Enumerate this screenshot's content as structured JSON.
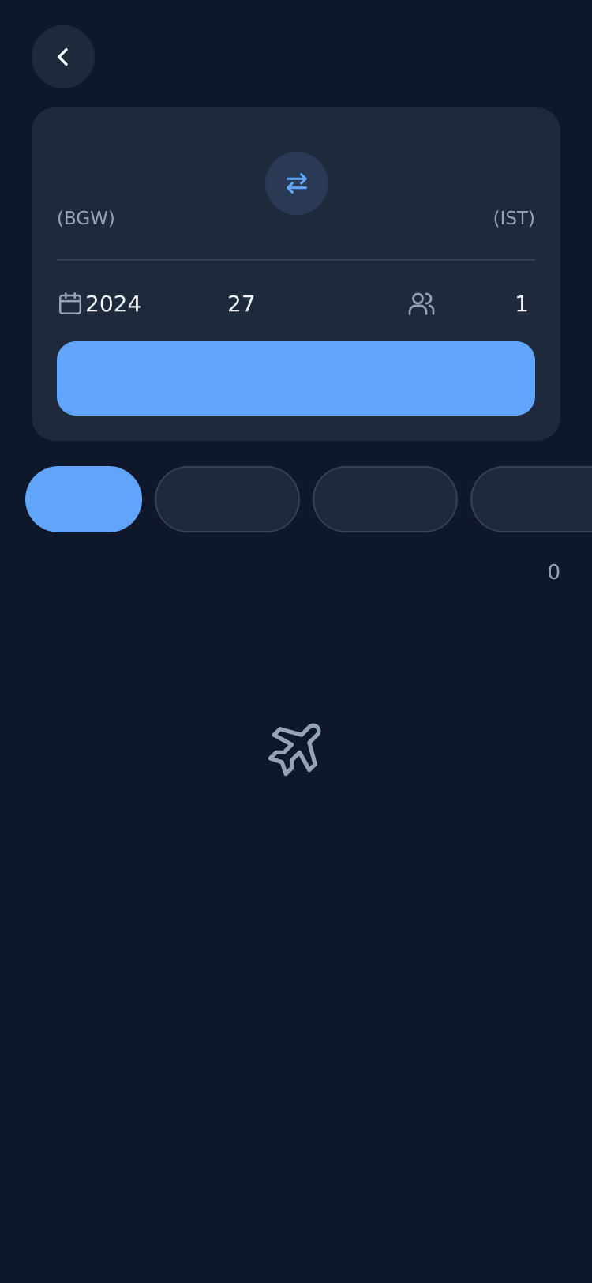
{
  "header": {
    "back_icon": "chevron-left-icon"
  },
  "search_card": {
    "swap_icon": "swap-arrows-icon",
    "origin_code": "(BGW)",
    "destination_code": "(IST)",
    "date_year": "2024",
    "date_day": "27",
    "passengers": "1",
    "search_button_label": ""
  },
  "filters": {
    "chips": [
      {
        "label": "",
        "active": true
      },
      {
        "label": "",
        "active": false
      },
      {
        "label": "",
        "active": false
      },
      {
        "label": "",
        "active": false
      }
    ]
  },
  "results": {
    "count": "0",
    "empty_icon": "airplane-icon"
  },
  "colors": {
    "background": "#0f172a",
    "card": "#1e293b",
    "accent": "#60a5fa",
    "muted_text": "#94a3b8"
  }
}
